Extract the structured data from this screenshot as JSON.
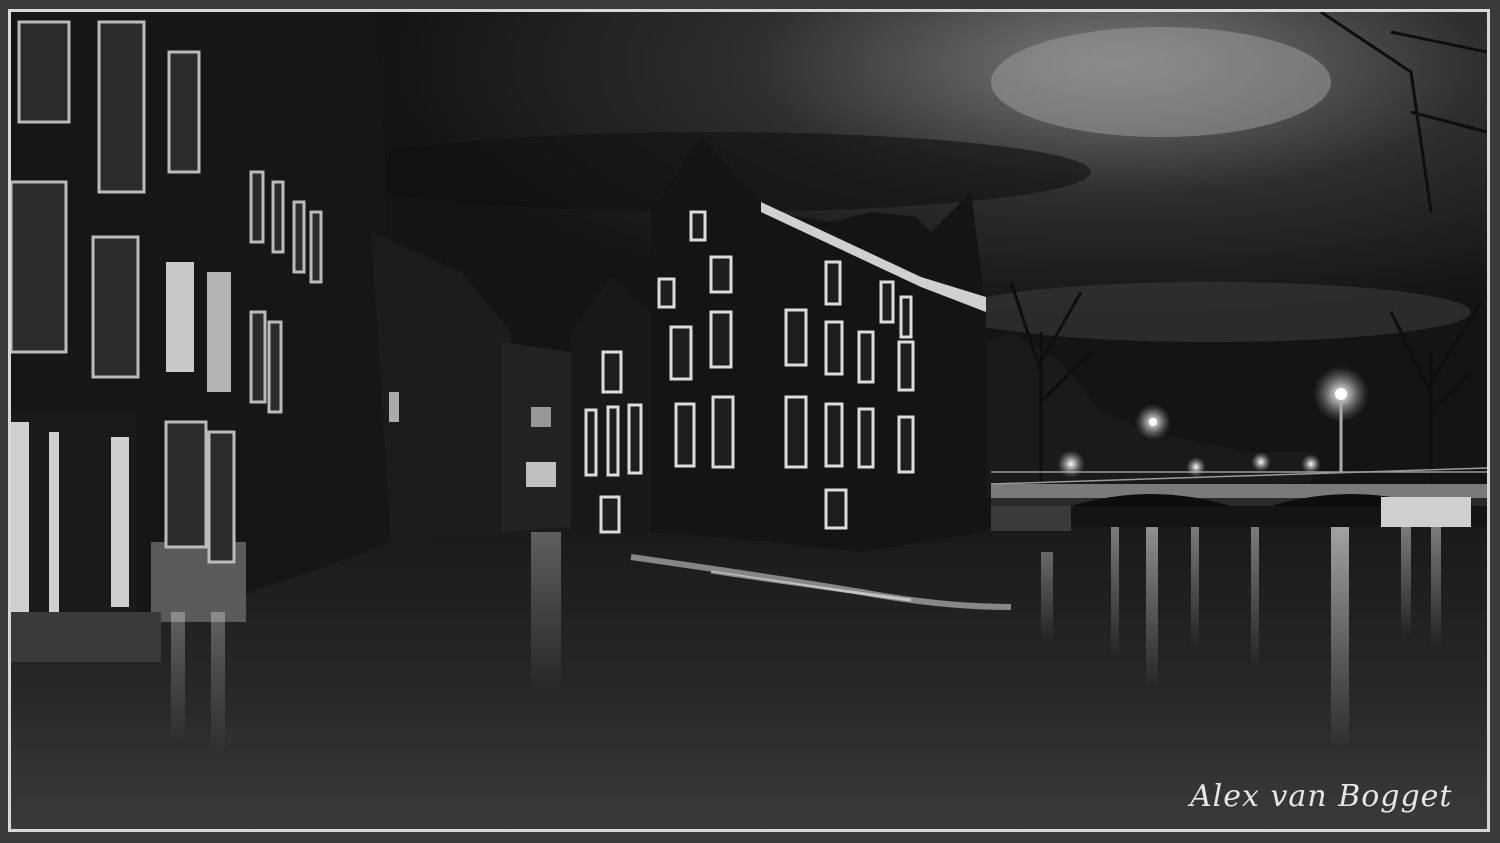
{
  "photo": {
    "subject": "canal-scene",
    "watermark_signature": "Alex van Bogget"
  },
  "colors": {
    "frame_outer": "#3a3a3a",
    "frame_inner": "#d8d8d8",
    "sky_top": "#1e1e1e",
    "sky_glow": "#6a6a6a",
    "water": "#121212",
    "reflection": "#cfcfcf",
    "lamp": "#ffffff"
  },
  "icons": [
    "street-lamp-icon"
  ]
}
